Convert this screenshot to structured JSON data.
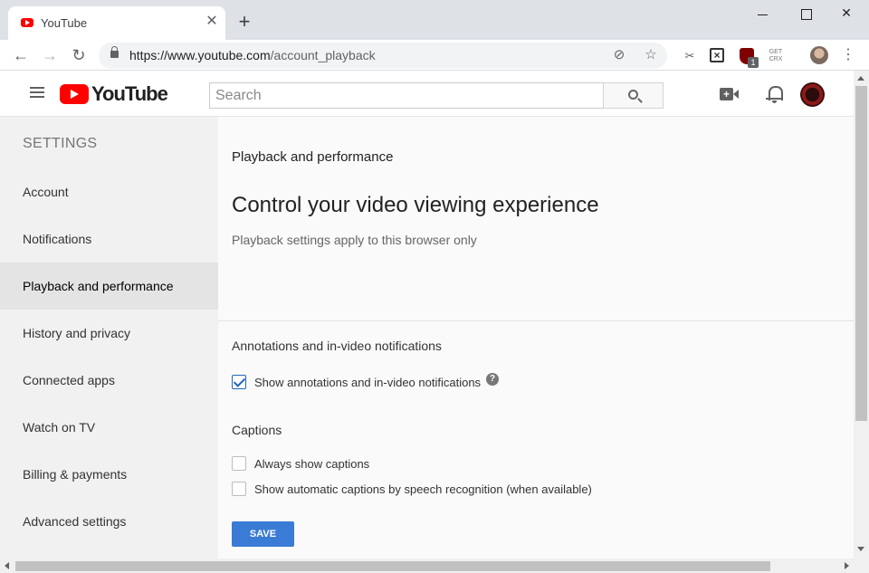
{
  "browser": {
    "tab_title": "YouTube",
    "tab_close_glyph": "✕",
    "new_tab_glyph": "+",
    "url_host": "https://www.youtube.com",
    "url_path": "/account_playback",
    "ext_crx_label": "GET CRX",
    "ext_badge_count": "1"
  },
  "masthead": {
    "logo_text": "YouTube",
    "search_placeholder": "Search"
  },
  "sidebar": {
    "heading": "SETTINGS",
    "items": [
      {
        "label": "Account"
      },
      {
        "label": "Notifications"
      },
      {
        "label": "Playback and performance",
        "active": true
      },
      {
        "label": "History and privacy"
      },
      {
        "label": "Connected apps"
      },
      {
        "label": "Watch on TV"
      },
      {
        "label": "Billing & payments"
      },
      {
        "label": "Advanced settings"
      }
    ]
  },
  "main": {
    "section_label": "Playback and performance",
    "headline": "Control your video viewing experience",
    "subtext": "Playback settings apply to this browser only",
    "annotations": {
      "title": "Annotations and in-video notifications",
      "option": {
        "label": "Show annotations and in-video notifications",
        "checked": true
      }
    },
    "captions": {
      "title": "Captions",
      "options": [
        {
          "label": "Always show captions",
          "checked": false
        },
        {
          "label": "Show automatic captions by speech recognition (when available)",
          "checked": false
        }
      ]
    },
    "save_label": "SAVE"
  },
  "colors": {
    "youtube_red": "#ff0000",
    "save_blue": "#3a7bd5",
    "checkbox_blue": "#2266bb"
  }
}
